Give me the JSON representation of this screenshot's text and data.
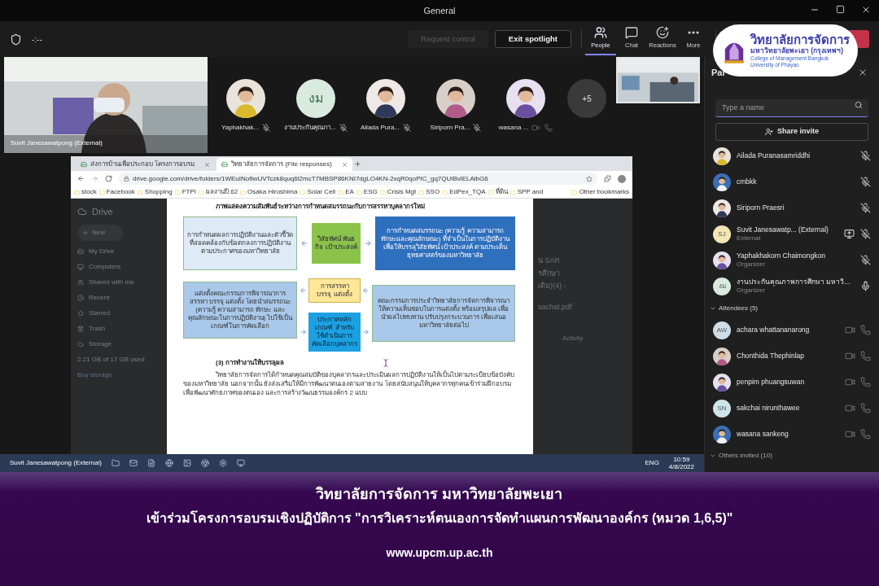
{
  "window": {
    "title": "General"
  },
  "toolbar": {
    "timer": "-:--",
    "buttons": [
      {
        "label": "Request control",
        "disabled": true
      },
      {
        "label": "Exit spotlight",
        "disabled": false
      }
    ],
    "tabs": [
      {
        "kind": "people",
        "label": "People",
        "selected": true
      },
      {
        "kind": "chat",
        "label": "Chat",
        "selected": false
      },
      {
        "kind": "reactions",
        "label": "Reactions",
        "selected": false
      },
      {
        "kind": "more",
        "label": "More",
        "selected": false
      }
    ]
  },
  "logo": {
    "title": "วิทยาลัยการจัดการ",
    "subtitle": "มหาวิทยาลัยพะเยา (กรุงเทพฯ)",
    "lines": [
      "College of Management Bangkok",
      "University of Phayao"
    ]
  },
  "stage": {
    "main_video": {
      "name": "Suvit Janesawatpong (External)"
    },
    "avatars": [
      {
        "name": "Yaphakhak...",
        "muted": true
      },
      {
        "name": "งานประกันคุณภา...",
        "kind": "initials",
        "initials": "งม",
        "color": "#d9eadf",
        "muted": true
      },
      {
        "name": "Ailada Pura...",
        "muted": true
      },
      {
        "name": "Siriporn Pra...",
        "muted": true
      },
      {
        "name": "wasana ...",
        "muted": false
      }
    ],
    "overflow": "+5"
  },
  "browser": {
    "tabs": [
      {
        "title": "ส่งการบ้านเพื่อประกอบ โครงการอบรม",
        "selected": false
      },
      {
        "title": "วิทยาลัยการจัดการ (File responses)",
        "selected": true
      }
    ],
    "url": "drive.google.com/drive/folders/1WEuINofIwUVTczk8quq6l2mcT7MBSP86KNI7dgLO4KN-2xqR0qoPIC_gq7QUIBvlELAlbG6",
    "bookmarks": [
      "stock",
      "Facebook",
      "Shopping",
      "FTPI",
      "ผลงานปี 62",
      "Osaka Hiroshima",
      "Solar Cell",
      "EA",
      "ESG",
      "Crisis Mgt",
      "SSO",
      "EdPex_TQA",
      "ที่ดิน",
      "SPP and"
    ],
    "other_bookmarks": "Other bookmarks",
    "drive": {
      "logo": "Drive",
      "new": "New",
      "nav": [
        "My Drive",
        "Computers",
        "Shared with me",
        "Recent",
        "Starred",
        "Trash",
        "Storage"
      ],
      "usage": "2.21 GB of 17 GB used",
      "buy": "Buy storage",
      "file_title": [
        "น SAR",
        "รศึกษา",
        "เดิม)(4) -"
      ],
      "file_name": "sachat.pdf",
      "activity": "Activity"
    },
    "document": {
      "heading": "ภาพแสดงความสัมพันธ์ระหว่างการกำหนดสมรรถนะกับการสรรหาบุคลากรใหม่",
      "boxes": [
        "การกำหนดผลการปฏิบัติงานและตัวชี้วัดที่สอดคล้องกับข้อตกลงการปฏิบัติงานตามประกาศของมหาวิทยาลัย",
        "วิสัยทัศน์ พันธกิจ เป้าประสงค์",
        "การกำหนดสมรรถนะ (ความรู้ ความสามารถ ทักษะและคุณลักษณะ) ที่จำเป็นในการปฏิบัติงาน เพื่อให้บรรลุวิสัยทัศน์ เป้าประสงค์ ตามประเด็นยุทธศาสตร์ของมหาวิทยาลัย",
        "แต่งตั้งคณะกรรมการพิจารณาการสรรหา บรรจุ แต่งตั้ง โดยนำสมรรถนะ (ความรู้ ความสามารถ ทักษะ และคุณลักษณะในการปฏิบัติงาน) ไปใช้เป็นเกณฑ์ในการคัดเลือก",
        "การสรรหา บรรจุ แต่งตั้ง",
        "คณะกรรมการประจำวิทยาลัยการจัดการพิจารณาให้ความเห็นชอบในการแต่งตั้ง พร้อมสรุปผล เพื่อนำผลไปทบทวน ปรับปรุงกระบวนการ เพื่อเสนอมหาวิทยาลัยต่อไป",
        "ประกาศหลักเกณฑ์ สำหรับใช้ดำเนินการ คัดเลือกบุคลากร"
      ],
      "section": "(3) การทำงานให้บรรลุผล",
      "paragraph": "วิทยาลัยการจัดการได้กำหนดคุณสมบัติของบุคลากรและประเมินผลการปฏิบัติงานให้เป็นไปตามระเบียบข้อบังคับของมหาวิทยาลัย นอกจากนั้น ยังส่งเสริมให้มีการพัฒนาตนเองตามสายงาน โดยสนับสนุนให้บุคลากรทุกคนเข้าร่วมฝึกอบรมเพื่อพัฒนาศักยภาพของตนเอง และการสร้างวัฒนธรรมองค์กร 2 แบบ"
    }
  },
  "taskbar": {
    "presenter": "Suvit Janesawatpong (External)",
    "lang": "ENG",
    "time": "10:59",
    "date": "4/8/2022"
  },
  "panel": {
    "title": "Par",
    "search": {
      "placeholder": "Type a name"
    },
    "share": "Share invite",
    "presenters": [
      {
        "name": "Ailada Puranasamriddhi",
        "muted": true
      },
      {
        "name": "cmbkk",
        "muted": true
      },
      {
        "name": "Siriporn Praesri",
        "muted": true
      },
      {
        "name": "Suvit Janesawatp... (External)",
        "role": "External",
        "kind": "initials",
        "initials": "SJ",
        "color": "#f3e6b3",
        "muted": true,
        "sharing": true
      },
      {
        "name": "Yaphakhakorn Chaimongkon",
        "role": "Organizer",
        "muted": true
      },
      {
        "name": "งานประกันคุณภาพการศึกษา มหาวิ...",
        "role": "Organizer",
        "kind": "initials",
        "initials": "งม",
        "color": "#d9eadf",
        "muted": false
      }
    ],
    "attendees_label": "Attendees (5)",
    "attendees": [
      {
        "name": "achara whattananarong",
        "kind": "initials",
        "initials": "AW",
        "color": "#cfdde8"
      },
      {
        "name": "Chonthida Thephinlap"
      },
      {
        "name": "penpim phuangsuwan"
      },
      {
        "name": "sakchai nirunthawee",
        "kind": "initials",
        "initials": "SN",
        "color": "#cfe4ea"
      },
      {
        "name": "wasana sankeng"
      }
    ],
    "others_label": "Others invited (10)"
  },
  "banner": {
    "title": "วิทยาลัยการจัดการ มหาวิทยาลัยพะเยา",
    "subtitle": "เข้าร่วมโครงการอบรมเชิงปฏิบัติการ \"การวิเคราะห์ตนเองการจัดทำแผนการพัฒนาองค์กร (หมวด 1,6,5)\"",
    "url": "www.upcm.up.ac.th"
  }
}
